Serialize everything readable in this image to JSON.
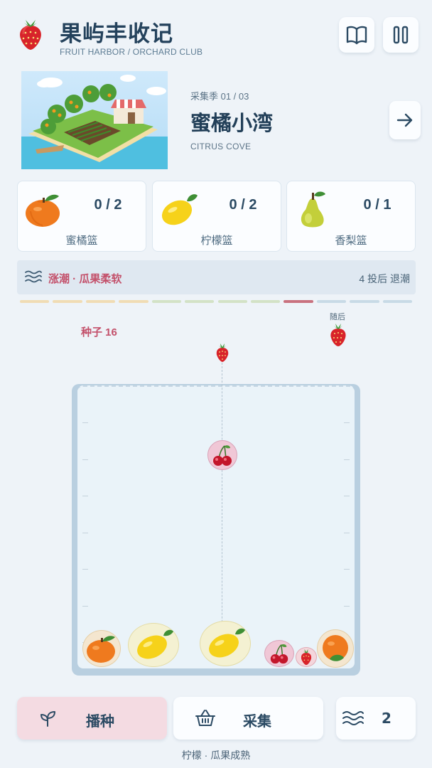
{
  "header": {
    "title": "果屿丰收记",
    "subtitle": "FRUIT HARBOR / ORCHARD CLUB",
    "logo_icon": "strawberry-icon",
    "book_icon": "book-icon",
    "pause_icon": "pause-icon"
  },
  "level": {
    "season": "采集季 01 / 03",
    "name": "蜜橘小湾",
    "name_en": "CITRUS COVE",
    "next_icon": "arrow-right-icon"
  },
  "baskets": [
    {
      "icon": "orange-icon",
      "count": "0 / 2",
      "label": "蜜橘篮"
    },
    {
      "icon": "lemon-icon",
      "count": "0 / 2",
      "label": "柠檬篮"
    },
    {
      "icon": "pear-icon",
      "count": "0 / 1",
      "label": "香梨篮"
    }
  ],
  "tide": {
    "text": "涨潮 · 瓜果柔软",
    "right": "4 投后 退潮",
    "segment_colors": [
      "#f0dcb4",
      "#f0dcb4",
      "#f0dcb4",
      "#f0dcb4",
      "#d3e2c6",
      "#d3e2c6",
      "#d3e2c6",
      "#d3e2c6",
      "#c9727f",
      "#c8dae6",
      "#c8dae6",
      "#c8dae6"
    ]
  },
  "game": {
    "seeds": "种子 16",
    "next_label": "随后",
    "current_fruit": "strawberry",
    "next_fruit": "strawberry"
  },
  "controls": {
    "plant": "播种",
    "harvest": "采集",
    "tide_count": "2"
  },
  "status": "柠檬 · 瓜果成熟",
  "colors": {
    "accent_pink": "#c3506a",
    "board_frame": "#b9cfe0",
    "background": "#eef3f8"
  }
}
